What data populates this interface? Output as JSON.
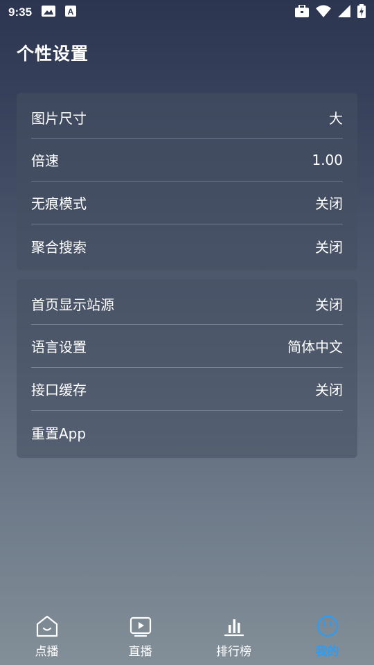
{
  "status_bar": {
    "time": "9:35",
    "icons": [
      "image-icon",
      "text-a-icon",
      "briefcase-icon",
      "wifi-icon",
      "signal-icon",
      "battery-charging-icon"
    ]
  },
  "header": {
    "title": "个性设置"
  },
  "settings_group_1": {
    "items": [
      {
        "label": "图片尺寸",
        "value": "大"
      },
      {
        "label": "倍速",
        "value": "1.00"
      },
      {
        "label": "无痕模式",
        "value": "关闭"
      },
      {
        "label": "聚合搜索",
        "value": "关闭"
      }
    ]
  },
  "settings_group_2": {
    "items": [
      {
        "label": "首页显示站源",
        "value": "关闭"
      },
      {
        "label": "语言设置",
        "value": "简体中文"
      },
      {
        "label": "接口缓存",
        "value": "关闭"
      },
      {
        "label": "重置App",
        "value": ""
      }
    ]
  },
  "bottom_nav": {
    "items": [
      {
        "label": "点播",
        "icon": "home-icon"
      },
      {
        "label": "直播",
        "icon": "play-icon"
      },
      {
        "label": "排行榜",
        "icon": "bar-chart-icon"
      },
      {
        "label": "我的",
        "icon": "smile-icon",
        "active": true
      }
    ]
  },
  "colors": {
    "accent": "#2e9cf0",
    "text": "#ffffff"
  }
}
